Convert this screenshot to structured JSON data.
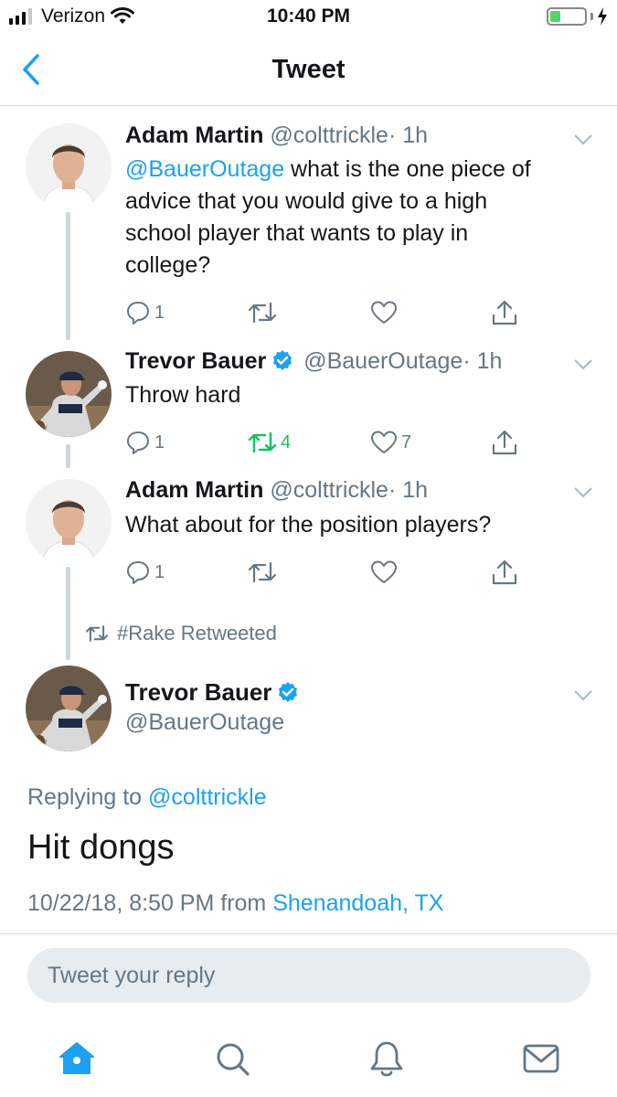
{
  "status_bar": {
    "carrier": "Verizon",
    "time": "10:40 PM",
    "signal_bars_active": 3,
    "signal_bars_total": 4,
    "battery_level": 0.3,
    "battery_color": "#4cd964"
  },
  "nav": {
    "back_icon": "chevron-left-icon",
    "title": "Tweet"
  },
  "colors": {
    "accent": "#1da1f2",
    "retweet_active": "#17bf63",
    "muted": "#657786",
    "verified": "#1da1f2"
  },
  "thread": [
    {
      "name": "Adam Martin",
      "handle": "@colttrickle",
      "time": "· 1h",
      "mention": "@BauerOutage",
      "text_lines": [
        " what is the one piece of",
        "advice that you would give to a high",
        "school player that wants to play in",
        "college?"
      ],
      "verified": false,
      "actions": {
        "reply_count": "1",
        "retweet_count": "",
        "like_count": ""
      }
    },
    {
      "name": "Trevor Bauer",
      "handle": "@BauerOutage",
      "time": "· 1h",
      "text": "Throw hard",
      "verified": true,
      "actions": {
        "reply_count": "1",
        "retweet_count": "4",
        "like_count": "7"
      }
    },
    {
      "name": "Adam Martin",
      "handle": "@colttrickle",
      "time": "· 1h",
      "text": "What about for the position players?",
      "verified": false,
      "actions": {
        "reply_count": "1",
        "retweet_count": "",
        "like_count": ""
      }
    }
  ],
  "retweet_note": "#Rake Retweeted",
  "main_tweet": {
    "name": "Trevor Bauer",
    "handle": "@BauerOutage",
    "replying_prefix": "Replying to ",
    "replying_to": "@colttrickle",
    "text": "Hit dongs",
    "timestamp_prefix": "10/22/18, 8:50 PM from ",
    "location": "Shenandoah, TX"
  },
  "reply_input": {
    "placeholder": "Tweet your reply",
    "value": ""
  },
  "tab_bar": [
    {
      "icon": "home-icon",
      "active": true
    },
    {
      "icon": "search-icon",
      "active": false
    },
    {
      "icon": "bell-icon",
      "active": false
    },
    {
      "icon": "mail-icon",
      "active": false
    }
  ]
}
